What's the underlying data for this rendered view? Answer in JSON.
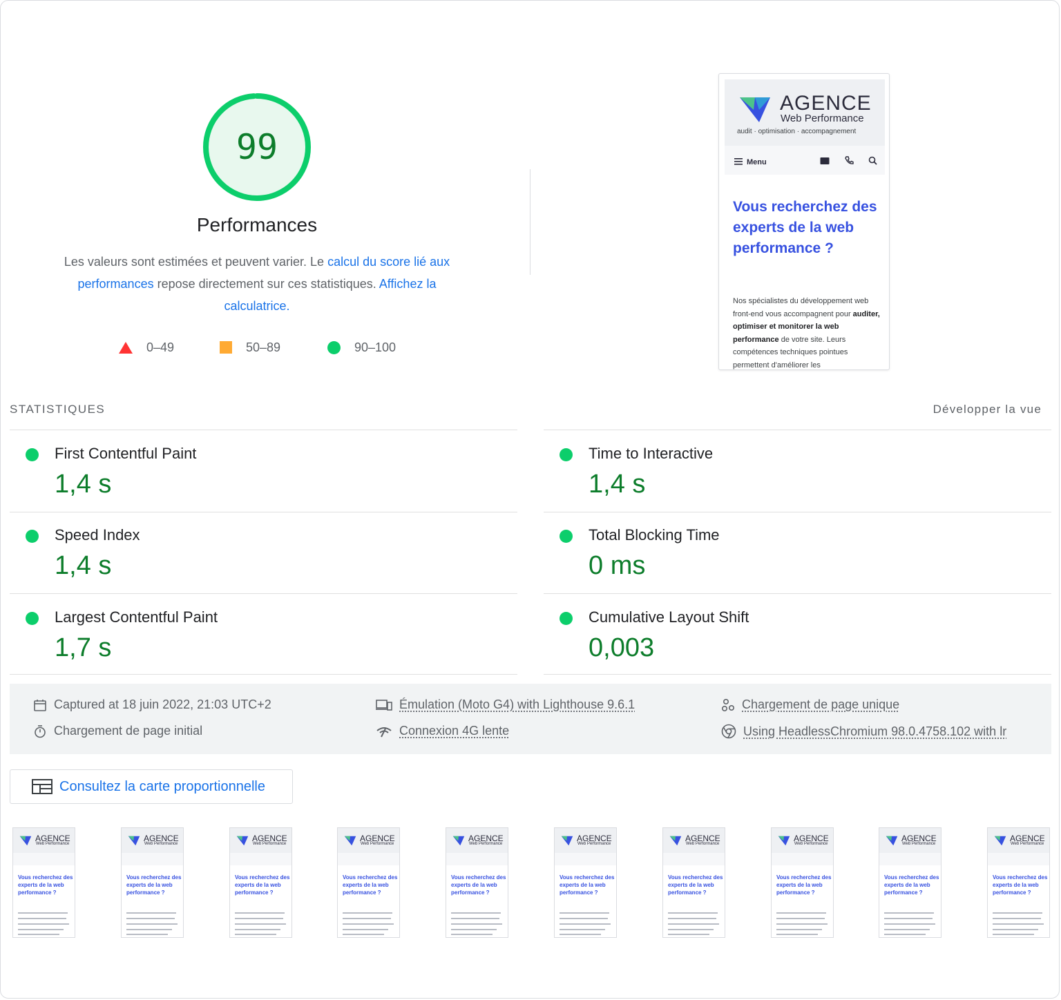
{
  "score": {
    "value": "99",
    "fraction": 0.99,
    "title": "Performances",
    "desc_1": "Les valeurs sont estimées et peuvent varier. Le ",
    "link_calc": "calcul du score lié aux performances",
    "desc_2": " repose directement sur ces statistiques. ",
    "link_calculator": "Affichez la calculatrice.",
    "colors": {
      "pass": "#0cce6b",
      "pass_text": "#0d7d2b",
      "average": "#ffaa33",
      "fail": "#ff3333"
    }
  },
  "legend": [
    {
      "range": "0–49",
      "icon": "red-triangle-icon"
    },
    {
      "range": "50–89",
      "icon": "orange-square-icon"
    },
    {
      "range": "90–100",
      "icon": "green-circle-icon"
    }
  ],
  "preview": {
    "brand": "AGENCE",
    "brand_sub": "Web Performance",
    "tagline": "audit · optimisation · accompagnement",
    "menu": "Menu",
    "heading": "Vous recherchez des experts de la web performance ?",
    "body_1": "Nos spécialistes du développement web front-end vous accompagnent pour ",
    "body_bold_1": "auditer, optimiser et monitorer la web performance",
    "body_2": " de votre site. Leurs compétences techniques pointues permettent d'améliorer les"
  },
  "metrics": {
    "section_title": "STATISTIQUES",
    "toggle_label": "Développer la vue",
    "items": [
      {
        "title": "First Contentful Paint",
        "value": "1,4 s"
      },
      {
        "title": "Time to Interactive",
        "value": "1,4 s"
      },
      {
        "title": "Speed Index",
        "value": "1,4 s"
      },
      {
        "title": "Total Blocking Time",
        "value": "0 ms"
      },
      {
        "title": "Largest Contentful Paint",
        "value": "1,7 s"
      },
      {
        "title": "Cumulative Layout Shift",
        "value": "0,003"
      }
    ]
  },
  "environment": {
    "captured": "Captured at 18 juin 2022, 21:03 UTC+2",
    "initial_load": "Chargement de page initial",
    "emulation": "Émulation (Moto G4) with Lighthouse 9.6.1",
    "connection": "Connexion 4G lente",
    "single_load": "Chargement de page unique",
    "browser": "Using HeadlessChromium 98.0.4758.102 with lr"
  },
  "treemap_button": "Consultez la carte proportionnelle",
  "filmstrip": {
    "brand": "AGENCE",
    "brand_sub": "Web Performance",
    "heading": "Vous recherchez des experts de la web performance ?",
    "frame_count": 10
  }
}
